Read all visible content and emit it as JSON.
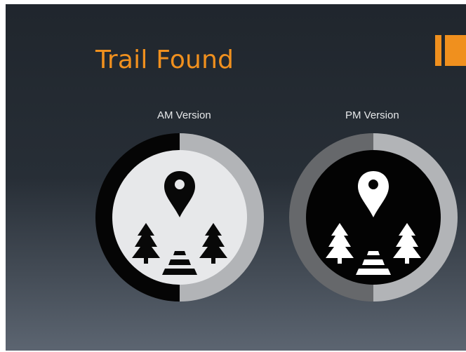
{
  "slide": {
    "title": "Trail Found",
    "accent_color": "#f0901e"
  },
  "versions": [
    {
      "label": "AM Version",
      "theme": "light",
      "icons": [
        "map-pin-icon",
        "pine-tree-icon",
        "pine-tree-icon",
        "trail-icon"
      ]
    },
    {
      "label": "PM Version",
      "theme": "dark",
      "icons": [
        "map-pin-icon",
        "pine-tree-icon",
        "pine-tree-icon",
        "trail-icon"
      ]
    }
  ]
}
